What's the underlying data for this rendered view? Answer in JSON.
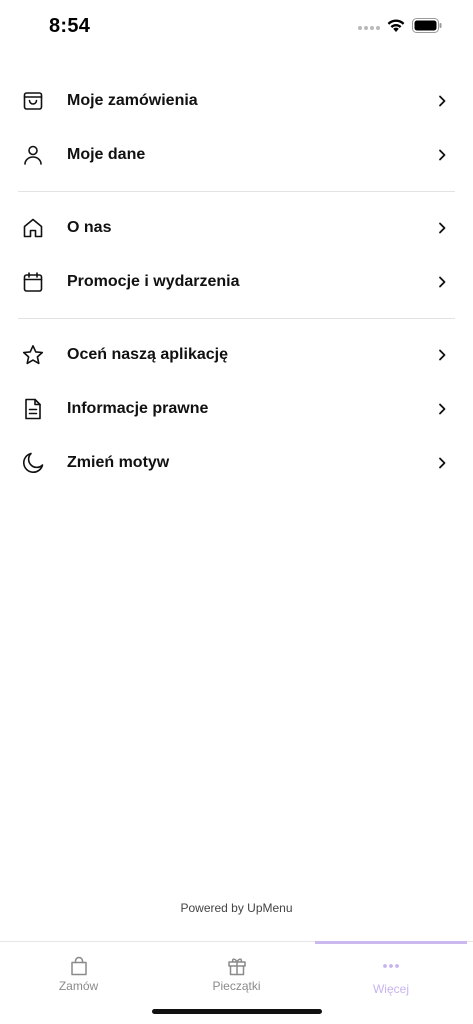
{
  "status": {
    "time": "8:54"
  },
  "menu": {
    "groups": [
      {
        "items": [
          {
            "label": "Moje zamówienia",
            "icon": "shopping-bag-icon"
          },
          {
            "label": "Moje dane",
            "icon": "user-icon"
          }
        ]
      },
      {
        "items": [
          {
            "label": "O nas",
            "icon": "home-icon"
          },
          {
            "label": "Promocje i wydarzenia",
            "icon": "calendar-icon"
          }
        ]
      },
      {
        "items": [
          {
            "label": "Oceń naszą aplikację",
            "icon": "star-icon"
          },
          {
            "label": "Informacje prawne",
            "icon": "document-icon"
          },
          {
            "label": "Zmień motyw",
            "icon": "moon-icon"
          }
        ]
      }
    ]
  },
  "footer": {
    "powered_by": "Powered by UpMenu"
  },
  "tabbar": {
    "tabs": [
      {
        "label": "Zamów",
        "icon": "bag-icon",
        "active": false
      },
      {
        "label": "Pieczątki",
        "icon": "gift-icon",
        "active": false
      },
      {
        "label": "Więcej",
        "icon": "more-dots-icon",
        "active": true
      }
    ]
  },
  "colors": {
    "accent": "#cbb8ee",
    "text": "#111111",
    "divider": "#e2e2e2"
  }
}
